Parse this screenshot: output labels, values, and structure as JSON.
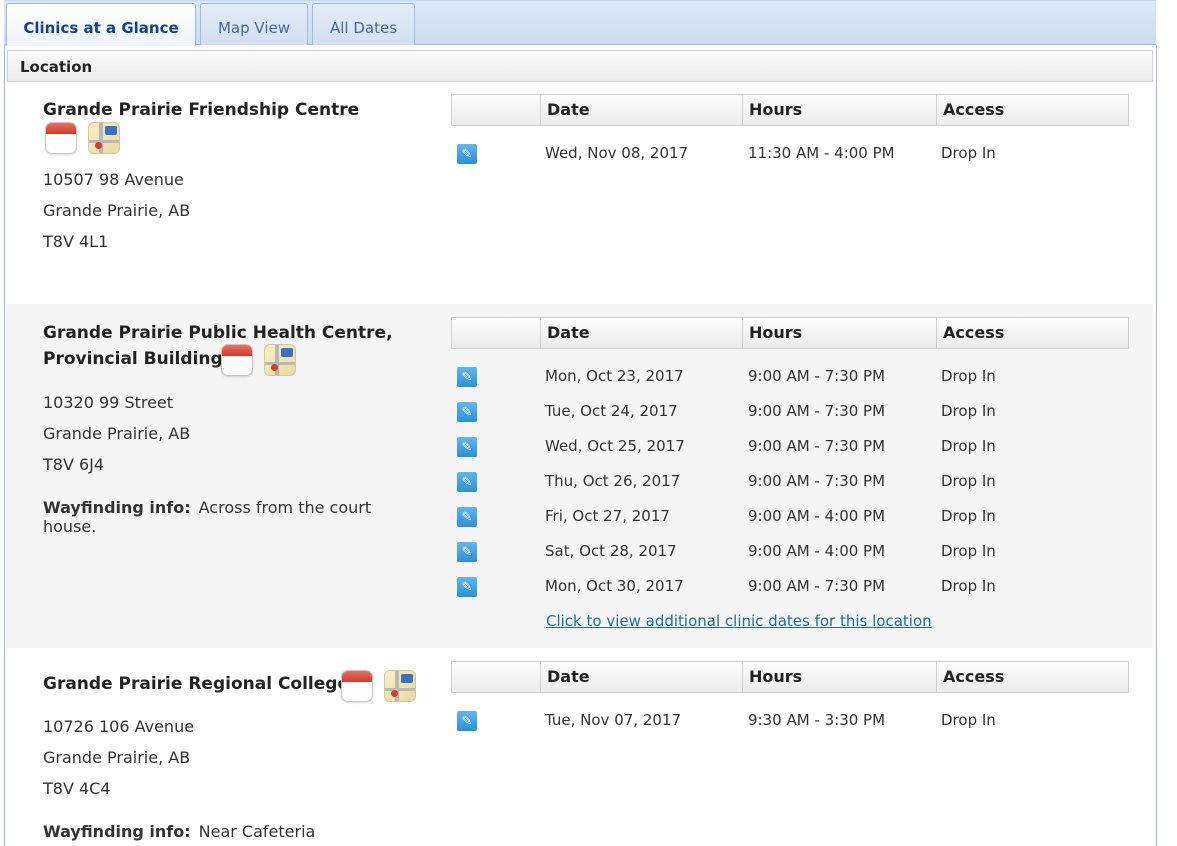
{
  "tabs": [
    {
      "label": "Clinics at a Glance",
      "active": true
    },
    {
      "label": "Map View",
      "active": false
    },
    {
      "label": "All Dates",
      "active": false
    }
  ],
  "header": {
    "location_label": "Location"
  },
  "table_headers": {
    "date": "Date",
    "hours": "Hours",
    "access": "Access"
  },
  "icons": {
    "calendar": "calendar-icon",
    "map": "map-icon",
    "edit": "edit-pencil-icon"
  },
  "clinics": [
    {
      "name": "Grande Prairie Friendship Centre",
      "address": [
        "10507  98 Avenue",
        "Grande Prairie, AB",
        "T8V 4L1"
      ],
      "sessions": [
        {
          "date": "Wed, Nov 08, 2017",
          "hours": "11:30 AM - 4:00 PM",
          "access": "Drop In"
        }
      ]
    },
    {
      "name_line1": "Grande Prairie Public Health Centre,",
      "name_line2": "Provincial Building",
      "address": [
        "10320  99 Street",
        "Grande Prairie, AB",
        "T8V 6J4"
      ],
      "wayfinding_label": "Wayfinding info:",
      "wayfinding": "Across from the court house.",
      "sessions": [
        {
          "date": "Mon, Oct 23, 2017",
          "hours": "9:00 AM - 7:30 PM",
          "access": "Drop In"
        },
        {
          "date": "Tue, Oct 24, 2017",
          "hours": "9:00 AM - 7:30 PM",
          "access": "Drop In"
        },
        {
          "date": "Wed, Oct 25, 2017",
          "hours": "9:00 AM - 7:30 PM",
          "access": "Drop In"
        },
        {
          "date": "Thu, Oct 26, 2017",
          "hours": "9:00 AM - 7:30 PM",
          "access": "Drop In"
        },
        {
          "date": "Fri, Oct 27, 2017",
          "hours": "9:00 AM - 4:00 PM",
          "access": "Drop In"
        },
        {
          "date": "Sat, Oct 28, 2017",
          "hours": "9:00 AM - 4:00 PM",
          "access": "Drop In"
        },
        {
          "date": "Mon, Oct 30, 2017",
          "hours": "9:00 AM - 7:30 PM",
          "access": "Drop In"
        }
      ],
      "more_link": "Click to view additional clinic dates for this location"
    },
    {
      "name": "Grande Prairie Regional College",
      "address": [
        "10726  106 Avenue",
        "Grande Prairie, AB",
        "T8V 4C4"
      ],
      "wayfinding_label": "Wayfinding info:",
      "wayfinding": "Near Cafeteria",
      "sessions": [
        {
          "date": "Tue, Nov 07, 2017",
          "hours": "9:30 AM - 3:30 PM",
          "access": "Drop In"
        }
      ]
    }
  ]
}
